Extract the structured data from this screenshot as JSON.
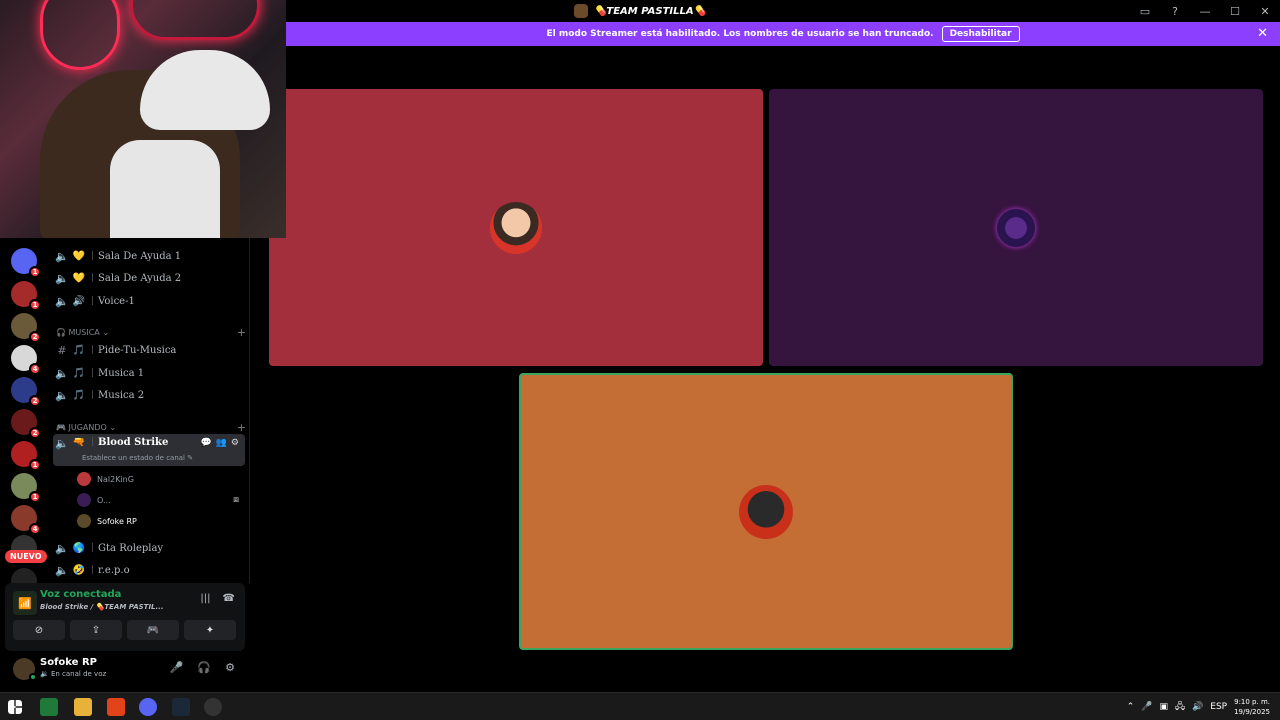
{
  "window": {
    "title": "💊TEAM PASTILLA💊"
  },
  "banner": {
    "message": "El modo Streamer está habilitado. Los nombres de usuario se han truncado.",
    "button": "Deshabilitar"
  },
  "rail": {
    "badges": [
      "1",
      "1",
      "2",
      "4",
      "2",
      "2",
      "1",
      "1",
      "4"
    ],
    "new_label": "NUEVO"
  },
  "channels": {
    "top_items": [
      {
        "emoji": "💛",
        "name": "Sala De Ayuda 1"
      },
      {
        "emoji": "💛",
        "name": "Sala De Ayuda 2"
      },
      {
        "emoji": "🔊",
        "name": "Voice-1"
      }
    ],
    "musica_category": "MUSICA",
    "musica_items": [
      {
        "emoji": "🎵",
        "name": "Pide-Tu-Musica"
      },
      {
        "emoji": "🎵",
        "name": "Musica 1"
      },
      {
        "emoji": "🎵",
        "name": "Musica 2"
      }
    ],
    "jugando_category": "JUGANDO",
    "active_channel": {
      "emoji": "🔫",
      "name": "Blood Strike",
      "status": "Establece un estado de canal"
    },
    "members": [
      "Nal2KinG",
      "O...",
      "Sofoke RP"
    ],
    "after_items": [
      {
        "emoji": "🌎",
        "name": "Gta Roleplay"
      },
      {
        "emoji": "🤣",
        "name": "r.e.p.o"
      }
    ]
  },
  "voice": {
    "connected": "Voz conectada",
    "location": "Blood Strike / 💊TEAM PASTIL..."
  },
  "user": {
    "name": "Sofoke RP",
    "status": "En canal de voz"
  },
  "taskbar": {
    "lang": "ESP",
    "time": "9:10 p. m.",
    "date": "19/9/2025"
  },
  "colors": {
    "banner": "#8c3fff",
    "tile_1": "#a22f3b",
    "tile_2": "#35143e",
    "tile_3": "#c46d35",
    "speaking_border": "#3ba55d",
    "connected_green": "#23a55a",
    "badge_red": "#f23f43"
  }
}
